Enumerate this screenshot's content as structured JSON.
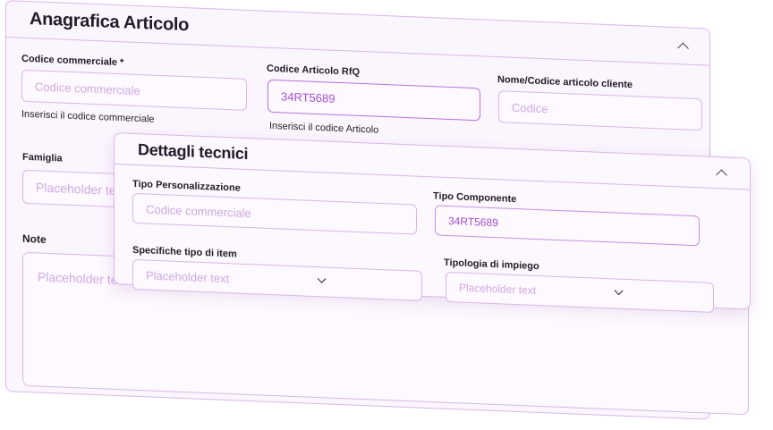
{
  "anagrafica": {
    "title": "Anagrafica Articolo",
    "codice_commerciale": {
      "label": "Codice commerciale *",
      "placeholder": "Codice commerciale",
      "helper": "Inserisci il codice commerciale"
    },
    "codice_rfq": {
      "label": "Codice Articolo RfQ",
      "value": "34RT5689",
      "helper": "Inserisci il codice Articolo"
    },
    "nome_codice_cliente": {
      "label": "Nome/Codice articolo cliente",
      "placeholder": "Codice"
    },
    "famiglia": {
      "label": "Famiglia",
      "placeholder": "Placeholder text"
    },
    "note": {
      "label": "Note",
      "placeholder": "Placeholder text"
    }
  },
  "dettagli": {
    "title": "Dettagli tecnici",
    "tipo_personalizzazione": {
      "label": "Tipo Personalizzazione",
      "placeholder": "Codice commerciale"
    },
    "tipo_componente": {
      "label": "Tipo Componente",
      "value": "34RT5689"
    },
    "specifiche_tipo_item": {
      "label": "Specifiche tipo di item",
      "placeholder": "Placeholder text"
    },
    "tipologia_impiego": {
      "label": "Tipologia di impiego",
      "placeholder": "Placeholder text"
    }
  },
  "icons": {
    "collapse": "chevron-up-icon",
    "dropdown": "chevron-down-icon"
  },
  "colors": {
    "accent": "#a24fd0",
    "border": "#d9b6ea",
    "placeholder": "#cfa9e3",
    "background": "#fbf6fe"
  }
}
